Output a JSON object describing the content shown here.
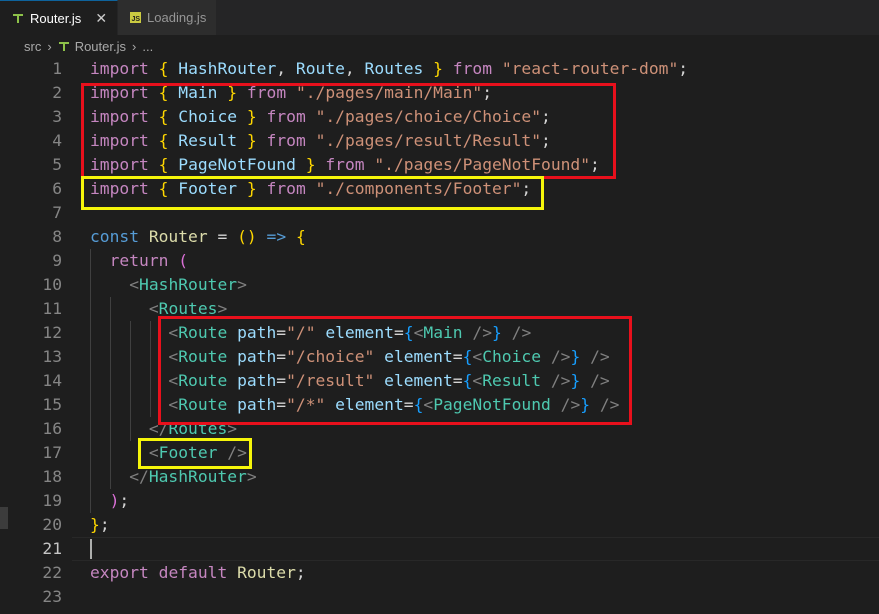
{
  "tabs": [
    {
      "label": "Router.js",
      "active": true,
      "close": "✕"
    },
    {
      "label": "Loading.js",
      "active": false
    }
  ],
  "breadcrumb": {
    "folder": "src",
    "file": "Router.js",
    "more": "..."
  },
  "editor": {
    "current_line": 21,
    "lines": [
      {
        "n": "1",
        "tokens": [
          [
            "k",
            "import"
          ],
          [
            "p",
            " "
          ],
          [
            "y",
            "{"
          ],
          [
            "p",
            " "
          ],
          [
            "v",
            "HashRouter"
          ],
          [
            "p",
            ", "
          ],
          [
            "v",
            "Route"
          ],
          [
            "p",
            ", "
          ],
          [
            "v",
            "Routes"
          ],
          [
            "p",
            " "
          ],
          [
            "y",
            "}"
          ],
          [
            "p",
            " "
          ],
          [
            "k",
            "from"
          ],
          [
            "p",
            " "
          ],
          [
            "s",
            "\"react-router-dom\""
          ],
          [
            "p",
            ";"
          ]
        ]
      },
      {
        "n": "2",
        "tokens": [
          [
            "k",
            "import"
          ],
          [
            "p",
            " "
          ],
          [
            "y",
            "{"
          ],
          [
            "p",
            " "
          ],
          [
            "v",
            "Main"
          ],
          [
            "p",
            " "
          ],
          [
            "y",
            "}"
          ],
          [
            "p",
            " "
          ],
          [
            "k",
            "from"
          ],
          [
            "p",
            " "
          ],
          [
            "s",
            "\"./pages/main/Main\""
          ],
          [
            "p",
            ";"
          ]
        ]
      },
      {
        "n": "3",
        "tokens": [
          [
            "k",
            "import"
          ],
          [
            "p",
            " "
          ],
          [
            "y",
            "{"
          ],
          [
            "p",
            " "
          ],
          [
            "v",
            "Choice"
          ],
          [
            "p",
            " "
          ],
          [
            "y",
            "}"
          ],
          [
            "p",
            " "
          ],
          [
            "k",
            "from"
          ],
          [
            "p",
            " "
          ],
          [
            "s",
            "\"./pages/choice/Choice\""
          ],
          [
            "p",
            ";"
          ]
        ]
      },
      {
        "n": "4",
        "tokens": [
          [
            "k",
            "import"
          ],
          [
            "p",
            " "
          ],
          [
            "y",
            "{"
          ],
          [
            "p",
            " "
          ],
          [
            "v",
            "Result"
          ],
          [
            "p",
            " "
          ],
          [
            "y",
            "}"
          ],
          [
            "p",
            " "
          ],
          [
            "k",
            "from"
          ],
          [
            "p",
            " "
          ],
          [
            "s",
            "\"./pages/result/Result\""
          ],
          [
            "p",
            ";"
          ]
        ]
      },
      {
        "n": "5",
        "tokens": [
          [
            "k",
            "import"
          ],
          [
            "p",
            " "
          ],
          [
            "y",
            "{"
          ],
          [
            "p",
            " "
          ],
          [
            "v",
            "PageNotFound"
          ],
          [
            "p",
            " "
          ],
          [
            "y",
            "}"
          ],
          [
            "p",
            " "
          ],
          [
            "k",
            "from"
          ],
          [
            "p",
            " "
          ],
          [
            "s",
            "\"./pages/PageNotFound\""
          ],
          [
            "p",
            ";"
          ]
        ]
      },
      {
        "n": "6",
        "tokens": [
          [
            "k",
            "import"
          ],
          [
            "p",
            " "
          ],
          [
            "y",
            "{"
          ],
          [
            "p",
            " "
          ],
          [
            "v",
            "Footer"
          ],
          [
            "p",
            " "
          ],
          [
            "y",
            "}"
          ],
          [
            "p",
            " "
          ],
          [
            "k",
            "from"
          ],
          [
            "p",
            " "
          ],
          [
            "s",
            "\"./components/Footer\""
          ],
          [
            "p",
            ";"
          ]
        ]
      },
      {
        "n": "7",
        "tokens": []
      },
      {
        "n": "8",
        "tokens": [
          [
            "b",
            "const"
          ],
          [
            "p",
            " "
          ],
          [
            "f",
            "Router"
          ],
          [
            "p",
            " = "
          ],
          [
            "y",
            "("
          ],
          [
            "y",
            ")"
          ],
          [
            "p",
            " "
          ],
          [
            "b",
            "=>"
          ],
          [
            "p",
            " "
          ],
          [
            "y",
            "{"
          ]
        ]
      },
      {
        "n": "9",
        "tokens": [
          [
            "p",
            "  "
          ],
          [
            "k",
            "return"
          ],
          [
            "p",
            " "
          ],
          [
            "pk",
            "("
          ]
        ]
      },
      {
        "n": "10",
        "tokens": [
          [
            "p",
            "    "
          ],
          [
            "g",
            "<"
          ],
          [
            "t",
            "HashRouter"
          ],
          [
            "g",
            ">"
          ]
        ]
      },
      {
        "n": "11",
        "tokens": [
          [
            "p",
            "      "
          ],
          [
            "g",
            "<"
          ],
          [
            "t",
            "Routes"
          ],
          [
            "g",
            ">"
          ]
        ]
      },
      {
        "n": "12",
        "tokens": [
          [
            "p",
            "        "
          ],
          [
            "g",
            "<"
          ],
          [
            "t",
            "Route"
          ],
          [
            "p",
            " "
          ],
          [
            "v",
            "path"
          ],
          [
            "p",
            "="
          ],
          [
            "s",
            "\"/\""
          ],
          [
            "p",
            " "
          ],
          [
            "v",
            "element"
          ],
          [
            "p",
            "="
          ],
          [
            "bl",
            "{"
          ],
          [
            "g",
            "<"
          ],
          [
            "t",
            "Main"
          ],
          [
            "p",
            " "
          ],
          [
            "g",
            "/>"
          ],
          [
            "bl",
            "}"
          ],
          [
            "p",
            " "
          ],
          [
            "g",
            "/>"
          ]
        ]
      },
      {
        "n": "13",
        "tokens": [
          [
            "p",
            "        "
          ],
          [
            "g",
            "<"
          ],
          [
            "t",
            "Route"
          ],
          [
            "p",
            " "
          ],
          [
            "v",
            "path"
          ],
          [
            "p",
            "="
          ],
          [
            "s",
            "\"/choice\""
          ],
          [
            "p",
            " "
          ],
          [
            "v",
            "element"
          ],
          [
            "p",
            "="
          ],
          [
            "bl",
            "{"
          ],
          [
            "g",
            "<"
          ],
          [
            "t",
            "Choice"
          ],
          [
            "p",
            " "
          ],
          [
            "g",
            "/>"
          ],
          [
            "bl",
            "}"
          ],
          [
            "p",
            " "
          ],
          [
            "g",
            "/>"
          ]
        ]
      },
      {
        "n": "14",
        "tokens": [
          [
            "p",
            "        "
          ],
          [
            "g",
            "<"
          ],
          [
            "t",
            "Route"
          ],
          [
            "p",
            " "
          ],
          [
            "v",
            "path"
          ],
          [
            "p",
            "="
          ],
          [
            "s",
            "\"/result\""
          ],
          [
            "p",
            " "
          ],
          [
            "v",
            "element"
          ],
          [
            "p",
            "="
          ],
          [
            "bl",
            "{"
          ],
          [
            "g",
            "<"
          ],
          [
            "t",
            "Result"
          ],
          [
            "p",
            " "
          ],
          [
            "g",
            "/>"
          ],
          [
            "bl",
            "}"
          ],
          [
            "p",
            " "
          ],
          [
            "g",
            "/>"
          ]
        ]
      },
      {
        "n": "15",
        "tokens": [
          [
            "p",
            "        "
          ],
          [
            "g",
            "<"
          ],
          [
            "t",
            "Route"
          ],
          [
            "p",
            " "
          ],
          [
            "v",
            "path"
          ],
          [
            "p",
            "="
          ],
          [
            "s",
            "\"/*\""
          ],
          [
            "p",
            " "
          ],
          [
            "v",
            "element"
          ],
          [
            "p",
            "="
          ],
          [
            "bl",
            "{"
          ],
          [
            "g",
            "<"
          ],
          [
            "t",
            "PageNotFound"
          ],
          [
            "p",
            " "
          ],
          [
            "g",
            "/>"
          ],
          [
            "bl",
            "}"
          ],
          [
            "p",
            " "
          ],
          [
            "g",
            "/>"
          ]
        ]
      },
      {
        "n": "16",
        "tokens": [
          [
            "p",
            "      "
          ],
          [
            "g",
            "</"
          ],
          [
            "t",
            "Routes"
          ],
          [
            "g",
            ">"
          ]
        ]
      },
      {
        "n": "17",
        "tokens": [
          [
            "p",
            "      "
          ],
          [
            "g",
            "<"
          ],
          [
            "t",
            "Footer"
          ],
          [
            "p",
            " "
          ],
          [
            "g",
            "/>"
          ]
        ]
      },
      {
        "n": "18",
        "tokens": [
          [
            "p",
            "    "
          ],
          [
            "g",
            "</"
          ],
          [
            "t",
            "HashRouter"
          ],
          [
            "g",
            ">"
          ]
        ]
      },
      {
        "n": "19",
        "tokens": [
          [
            "p",
            "  "
          ],
          [
            "pk",
            ")"
          ],
          [
            "p",
            ";"
          ]
        ]
      },
      {
        "n": "20",
        "tokens": [
          [
            "y",
            "}"
          ],
          [
            "p",
            ";"
          ]
        ]
      },
      {
        "n": "21",
        "tokens": []
      },
      {
        "n": "22",
        "tokens": [
          [
            "k",
            "export"
          ],
          [
            "p",
            " "
          ],
          [
            "k",
            "default"
          ],
          [
            "p",
            " "
          ],
          [
            "f",
            "Router"
          ],
          [
            "p",
            ";"
          ]
        ]
      },
      {
        "n": "23",
        "tokens": []
      }
    ]
  },
  "colors": {
    "red_highlight": "#e8101c",
    "yellow_highlight": "#f5f50a",
    "editor_bg": "#1e1e1e"
  }
}
